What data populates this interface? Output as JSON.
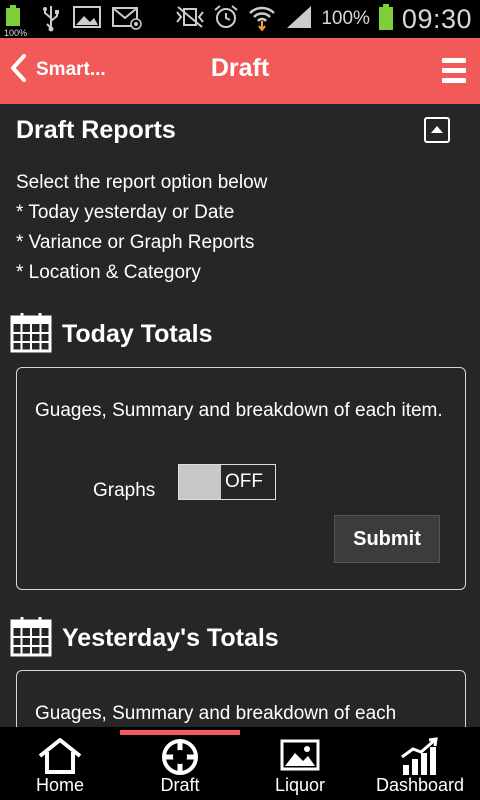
{
  "status_bar": {
    "battery_small_label": "100%",
    "battery_percent": "100%",
    "time": "09:30"
  },
  "header": {
    "back_label": "Smart...",
    "title": "Draft"
  },
  "section": {
    "title": "Draft Reports",
    "intro_lines": [
      "Select the report option below",
      "* Today yesterday or Date",
      "* Variance or Graph Reports",
      "* Location & Category"
    ]
  },
  "today": {
    "heading": "Today Totals",
    "description": "Guages, Summary and breakdown of each item.",
    "graphs_label": "Graphs",
    "toggle_text": "OFF",
    "submit_label": "Submit"
  },
  "yesterday": {
    "heading": "Yesterday's Totals",
    "description": "Guages, Summary and breakdown of each"
  },
  "bottom_nav": {
    "items": [
      {
        "label": "Home",
        "icon": "home-icon"
      },
      {
        "label": "Draft",
        "icon": "target-icon"
      },
      {
        "label": "Liquor",
        "icon": "image-icon"
      },
      {
        "label": "Dashboard",
        "icon": "chart-icon"
      }
    ],
    "active": "Draft"
  },
  "colors": {
    "accent": "#f25a5a",
    "background": "#262626",
    "status_bar": "#000000"
  }
}
